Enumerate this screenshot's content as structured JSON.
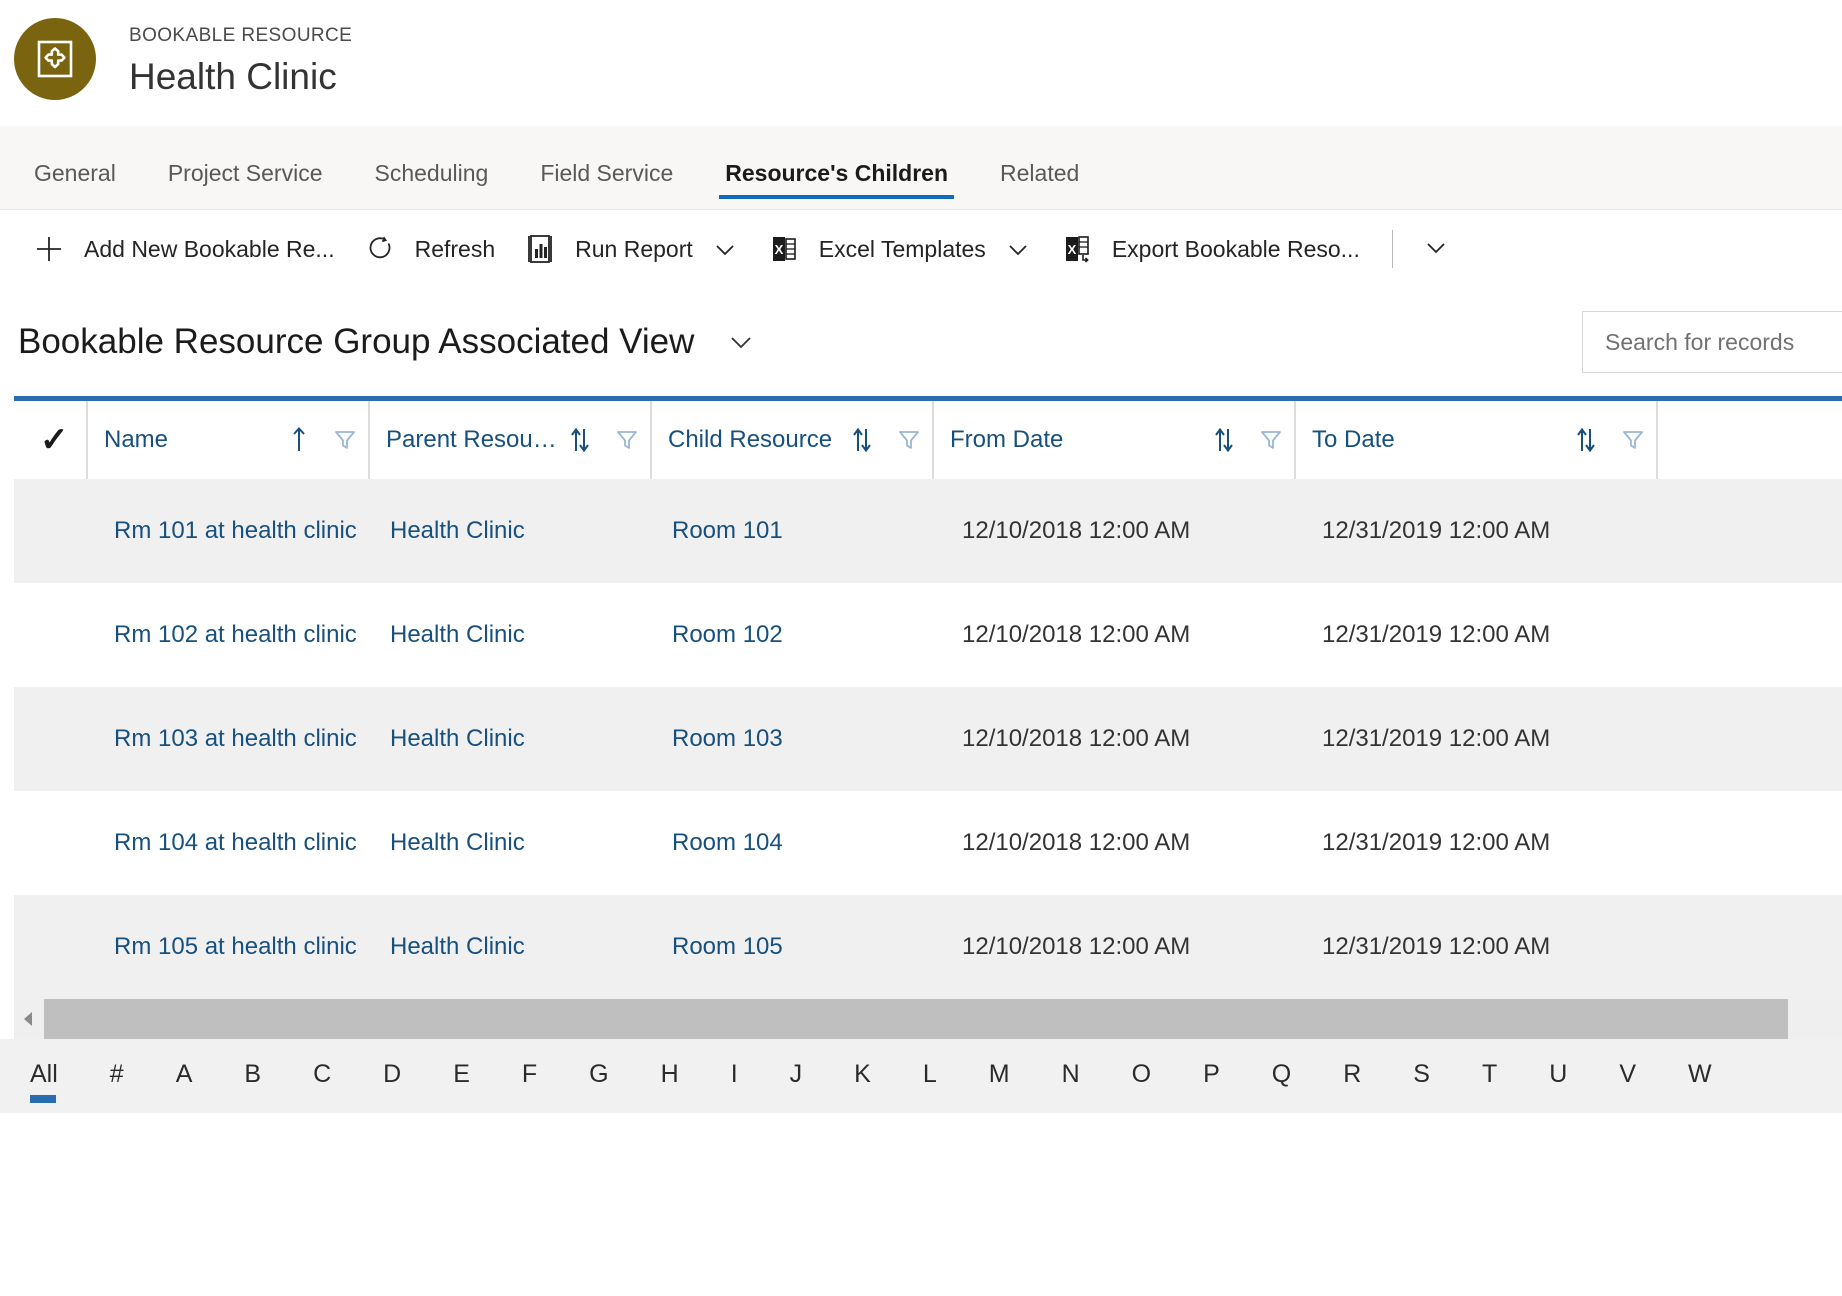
{
  "header": {
    "entity_type": "BOOKABLE RESOURCE",
    "record_title": "Health Clinic",
    "avatar_icon": "bookable-resource-icon",
    "avatar_color": "#7a6410"
  },
  "tabs": [
    {
      "label": "General",
      "selected": false
    },
    {
      "label": "Project Service",
      "selected": false
    },
    {
      "label": "Scheduling",
      "selected": false
    },
    {
      "label": "Field Service",
      "selected": false
    },
    {
      "label": "Resource's Children",
      "selected": true
    },
    {
      "label": "Related",
      "selected": false
    }
  ],
  "command_bar": {
    "items": [
      {
        "label": "Add New Bookable Re...",
        "icon": "plus-icon",
        "chevron": false
      },
      {
        "label": "Refresh",
        "icon": "refresh-icon",
        "chevron": false
      },
      {
        "label": "Run Report",
        "icon": "report-icon",
        "chevron": true
      },
      {
        "label": "Excel Templates",
        "icon": "excel-icon",
        "chevron": true
      },
      {
        "label": "Export Bookable Reso...",
        "icon": "excel-export-icon",
        "chevron": false
      }
    ],
    "overflow_icon": "chevron-down-icon"
  },
  "view": {
    "title": "Bookable Resource Group Associated View",
    "chevron_icon": "chevron-down-icon"
  },
  "search": {
    "placeholder": "Search for records",
    "value": ""
  },
  "grid": {
    "select_all_icon": "checkmark-icon",
    "columns": [
      {
        "label": "Name",
        "sort": "ascending",
        "sort_icon": "sort-ascending-icon",
        "filter_icon": "filter-icon"
      },
      {
        "label": "Parent Resour...",
        "sort": "none",
        "sort_icon": "sort-icon",
        "filter_icon": "filter-icon"
      },
      {
        "label": "Child Resource",
        "sort": "none",
        "sort_icon": "sort-icon",
        "filter_icon": "filter-icon"
      },
      {
        "label": "From Date",
        "sort": "none",
        "sort_icon": "sort-icon",
        "filter_icon": "filter-icon"
      },
      {
        "label": "To Date",
        "sort": "none",
        "sort_icon": "sort-icon",
        "filter_icon": "filter-icon"
      }
    ],
    "rows": [
      {
        "name": "Rm 101 at health clinic",
        "parent_resource": "Health Clinic",
        "child_resource": "Room 101",
        "from_date": "12/10/2018 12:00 AM",
        "to_date": "12/31/2019 12:00 AM"
      },
      {
        "name": "Rm 102 at health clinic",
        "parent_resource": "Health Clinic",
        "child_resource": "Room 102",
        "from_date": "12/10/2018 12:00 AM",
        "to_date": "12/31/2019 12:00 AM"
      },
      {
        "name": "Rm 103 at health clinic",
        "parent_resource": "Health Clinic",
        "child_resource": "Room 103",
        "from_date": "12/10/2018 12:00 AM",
        "to_date": "12/31/2019 12:00 AM"
      },
      {
        "name": "Rm 104 at health clinic",
        "parent_resource": "Health Clinic",
        "child_resource": "Room 104",
        "from_date": "12/10/2018 12:00 AM",
        "to_date": "12/31/2019 12:00 AM"
      },
      {
        "name": "Rm 105 at health clinic",
        "parent_resource": "Health Clinic",
        "child_resource": "Room 105",
        "from_date": "12/10/2018 12:00 AM",
        "to_date": "12/31/2019 12:00 AM"
      }
    ]
  },
  "alphabet_index": {
    "items": [
      "All",
      "#",
      "A",
      "B",
      "C",
      "D",
      "E",
      "F",
      "G",
      "H",
      "I",
      "J",
      "K",
      "L",
      "M",
      "N",
      "O",
      "P",
      "Q",
      "R",
      "S",
      "T",
      "U",
      "V",
      "W"
    ],
    "selected": "All",
    "accent_color": "#2b6cb0"
  },
  "scrollbar": {
    "left_arrow_icon": "caret-left-icon"
  }
}
